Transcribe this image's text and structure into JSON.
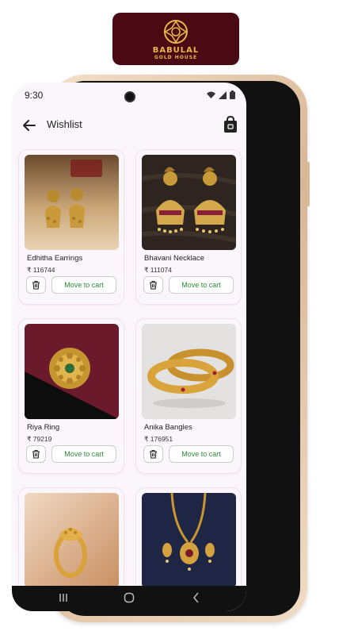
{
  "brand": {
    "name": "BABULAL",
    "tagline": "GOLD HOUSE",
    "badge_color": "#4a0a14",
    "accent": "#e8b84a"
  },
  "status_bar": {
    "time": "9:30",
    "icons": [
      "wifi-icon",
      "signal-icon",
      "battery-icon"
    ]
  },
  "header": {
    "title": "Wishlist",
    "back_icon": "back-arrow-icon",
    "cart_icon": "shopping-bag-icon"
  },
  "actions": {
    "move_to_cart_label": "Move to cart",
    "delete_icon": "trash-icon",
    "cta_color": "#2e8b3a"
  },
  "items": [
    {
      "name": "Edhitha Earrings",
      "price": "₹ 116744",
      "image": "gold-jhumka-earrings"
    },
    {
      "name": "Bhavani Necklace",
      "price": "₹ 111074",
      "image": "peacock-jhumka-earrings"
    },
    {
      "name": "Riya Ring",
      "price": "₹ 79219",
      "image": "gold-flower-ring"
    },
    {
      "name": "Anika Bangles",
      "price": "₹ 176951",
      "image": "gold-bangles"
    },
    {
      "name": "",
      "price": "",
      "image": "gold-ring"
    },
    {
      "name": "",
      "price": "",
      "image": "gold-necklace-set"
    }
  ],
  "nav": {
    "icons": [
      "recents-icon",
      "home-icon",
      "back-nav-icon"
    ]
  }
}
